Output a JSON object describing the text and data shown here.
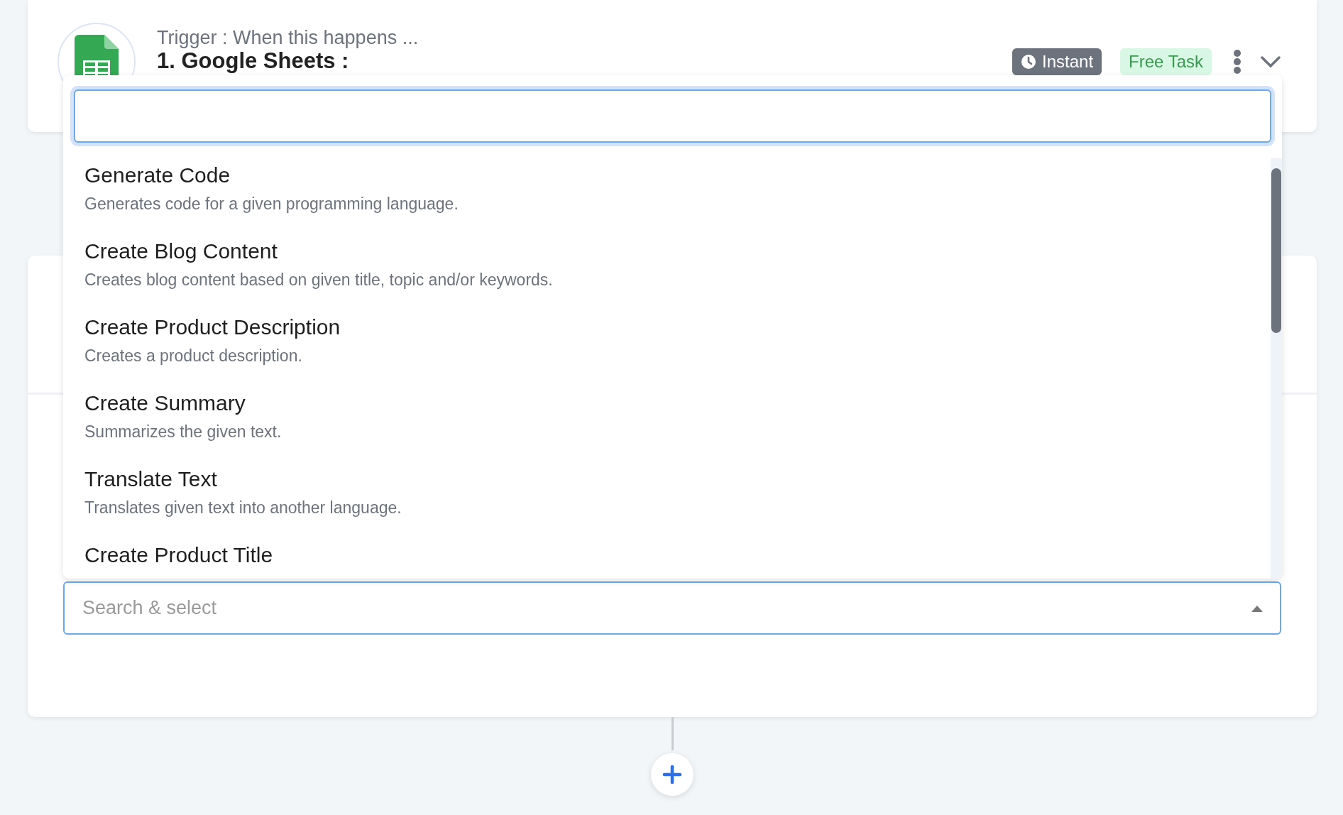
{
  "trigger_card": {
    "label": "Trigger : When this happens ...",
    "title": "1. Google Sheets :",
    "badges": [
      {
        "kind": "instant",
        "text": "Instant"
      },
      {
        "kind": "free",
        "text": "Free Task"
      }
    ]
  },
  "action_select": {
    "placeholder": "Search & select",
    "expanded": true,
    "options": [
      {
        "title": "Generate Code",
        "description": "Generates code for a given programming language."
      },
      {
        "title": "Create Blog Content",
        "description": "Creates blog content based on given title, topic and/or keywords."
      },
      {
        "title": "Create Product Description",
        "description": "Creates a product description."
      },
      {
        "title": "Create Summary",
        "description": "Summarizes the given text."
      },
      {
        "title": "Translate Text",
        "description": "Translates given text into another language."
      },
      {
        "title": "Create Product Title"
      }
    ]
  }
}
